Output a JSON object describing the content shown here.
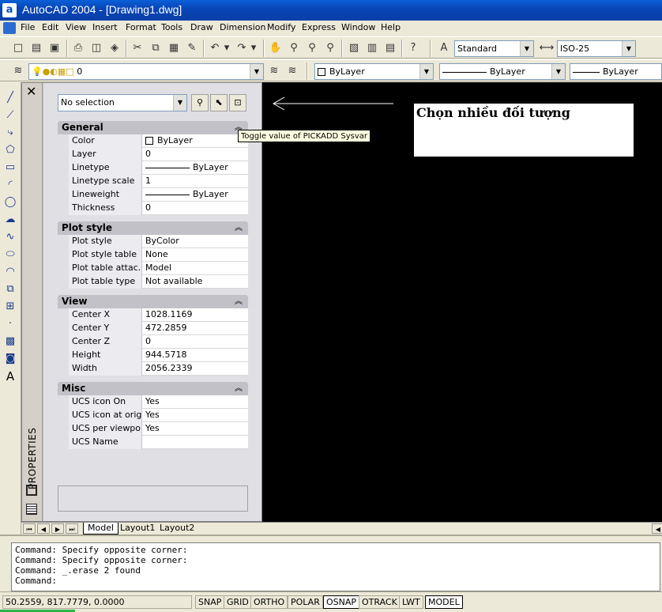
{
  "window": {
    "title": "AutoCAD 2004 - [Drawing1.dwg]",
    "app_icon": "a"
  },
  "menubar": [
    "File",
    "Edit",
    "View",
    "Insert",
    "Format",
    "Tools",
    "Draw",
    "Dimension",
    "Modify",
    "Express",
    "Window",
    "Help"
  ],
  "toolbar": {
    "text_style": "Standard",
    "dim_style": "ISO-25",
    "layer": "0",
    "color": "ByLayer",
    "linetype": "ByLayer",
    "lineweight": "ByLayer"
  },
  "palette": {
    "vertical_label": "PROPERTIES",
    "selection": "No selection",
    "tooltip": "Toggle value of PICKADD Sysvar",
    "sections": {
      "general": {
        "title": "General",
        "rows": [
          {
            "name": "Color",
            "value": "ByLayer"
          },
          {
            "name": "Layer",
            "value": "0"
          },
          {
            "name": "Linetype",
            "value": "ByLayer"
          },
          {
            "name": "Linetype scale",
            "value": "1"
          },
          {
            "name": "Lineweight",
            "value": "ByLayer"
          },
          {
            "name": "Thickness",
            "value": "0"
          }
        ]
      },
      "plot": {
        "title": "Plot style",
        "rows": [
          {
            "name": "Plot style",
            "value": "ByColor"
          },
          {
            "name": "Plot style table",
            "value": "None"
          },
          {
            "name": "Plot table attac...",
            "value": "Model"
          },
          {
            "name": "Plot table type",
            "value": "Not available"
          }
        ]
      },
      "view": {
        "title": "View",
        "rows": [
          {
            "name": "Center X",
            "value": "1028.1169"
          },
          {
            "name": "Center Y",
            "value": "472.2859"
          },
          {
            "name": "Center Z",
            "value": "0"
          },
          {
            "name": "Height",
            "value": "944.5718"
          },
          {
            "name": "Width",
            "value": "2056.2339"
          }
        ]
      },
      "misc": {
        "title": "Misc",
        "rows": [
          {
            "name": "UCS icon On",
            "value": "Yes"
          },
          {
            "name": "UCS icon at origin",
            "value": "Yes"
          },
          {
            "name": "UCS per viewport",
            "value": "Yes"
          },
          {
            "name": "UCS Name",
            "value": ""
          }
        ]
      }
    }
  },
  "canvas": {
    "annotation": "Chọn nhiều đối tượng"
  },
  "layout_tabs": [
    "Model",
    "Layout1",
    "Layout2"
  ],
  "command_lines": [
    "Command: Specify opposite corner:",
    "Command: Specify opposite corner:",
    "Command: _.erase 2 found",
    "Command:"
  ],
  "statusbar": {
    "coords": "50.2559,  817.7779, 0.0000",
    "buttons": [
      "SNAP",
      "GRID",
      "ORTHO",
      "POLAR",
      "OSNAP",
      "OTRACK",
      "LWT",
      "MODEL"
    ]
  }
}
